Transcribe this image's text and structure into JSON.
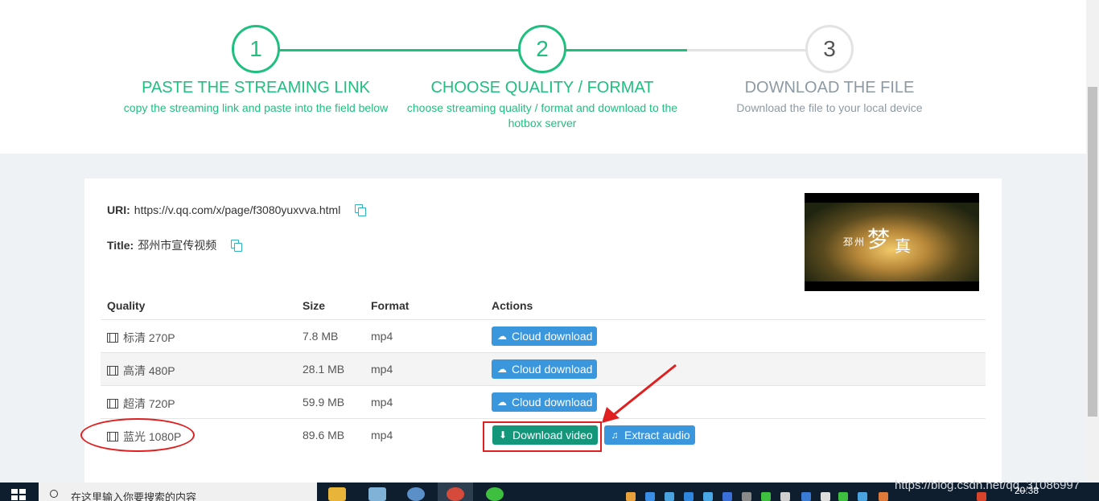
{
  "steps": [
    {
      "number": "1",
      "title": "PASTE THE STREAMING LINK",
      "desc": "copy the streaming link and paste into the field below"
    },
    {
      "number": "2",
      "title": "CHOOSE QUALITY / FORMAT",
      "desc": "choose streaming quality / format and download to the hotbox server"
    },
    {
      "number": "3",
      "title": "DOWNLOAD THE FILE",
      "desc": "Download the file to your local device"
    }
  ],
  "info": {
    "uri_label": "URI:",
    "uri_value": "https://v.qq.com/x/page/f3080yuxvva.html",
    "title_label": "Title:",
    "title_value": "邳州市宣传视频"
  },
  "thumbnail": {
    "text_small": "邳州",
    "text_big": "梦",
    "text_big2": "真"
  },
  "table": {
    "headers": {
      "quality": "Quality",
      "size": "Size",
      "format": "Format",
      "actions": "Actions"
    },
    "rows": [
      {
        "quality": "标清 270P",
        "size": "7.8 MB",
        "format": "mp4",
        "action": "Cloud download"
      },
      {
        "quality": "高清 480P",
        "size": "28.1 MB",
        "format": "mp4",
        "action": "Cloud download"
      },
      {
        "quality": "超清 720P",
        "size": "59.9 MB",
        "format": "mp4",
        "action": "Cloud download"
      },
      {
        "quality": "蓝光 1080P",
        "size": "89.6 MB",
        "format": "mp4",
        "action": "Download video",
        "action2": "Extract audio"
      }
    ]
  },
  "taskbar": {
    "search_placeholder": "在这里输入你要搜索的内容",
    "watermark": "https://blog.csdn.net/qq_31086997",
    "clock": "20:38"
  },
  "colors": {
    "accent": "#1fbf7f",
    "button_blue": "#3a97de",
    "button_green": "#14967a",
    "annotation_red": "#e02020"
  }
}
